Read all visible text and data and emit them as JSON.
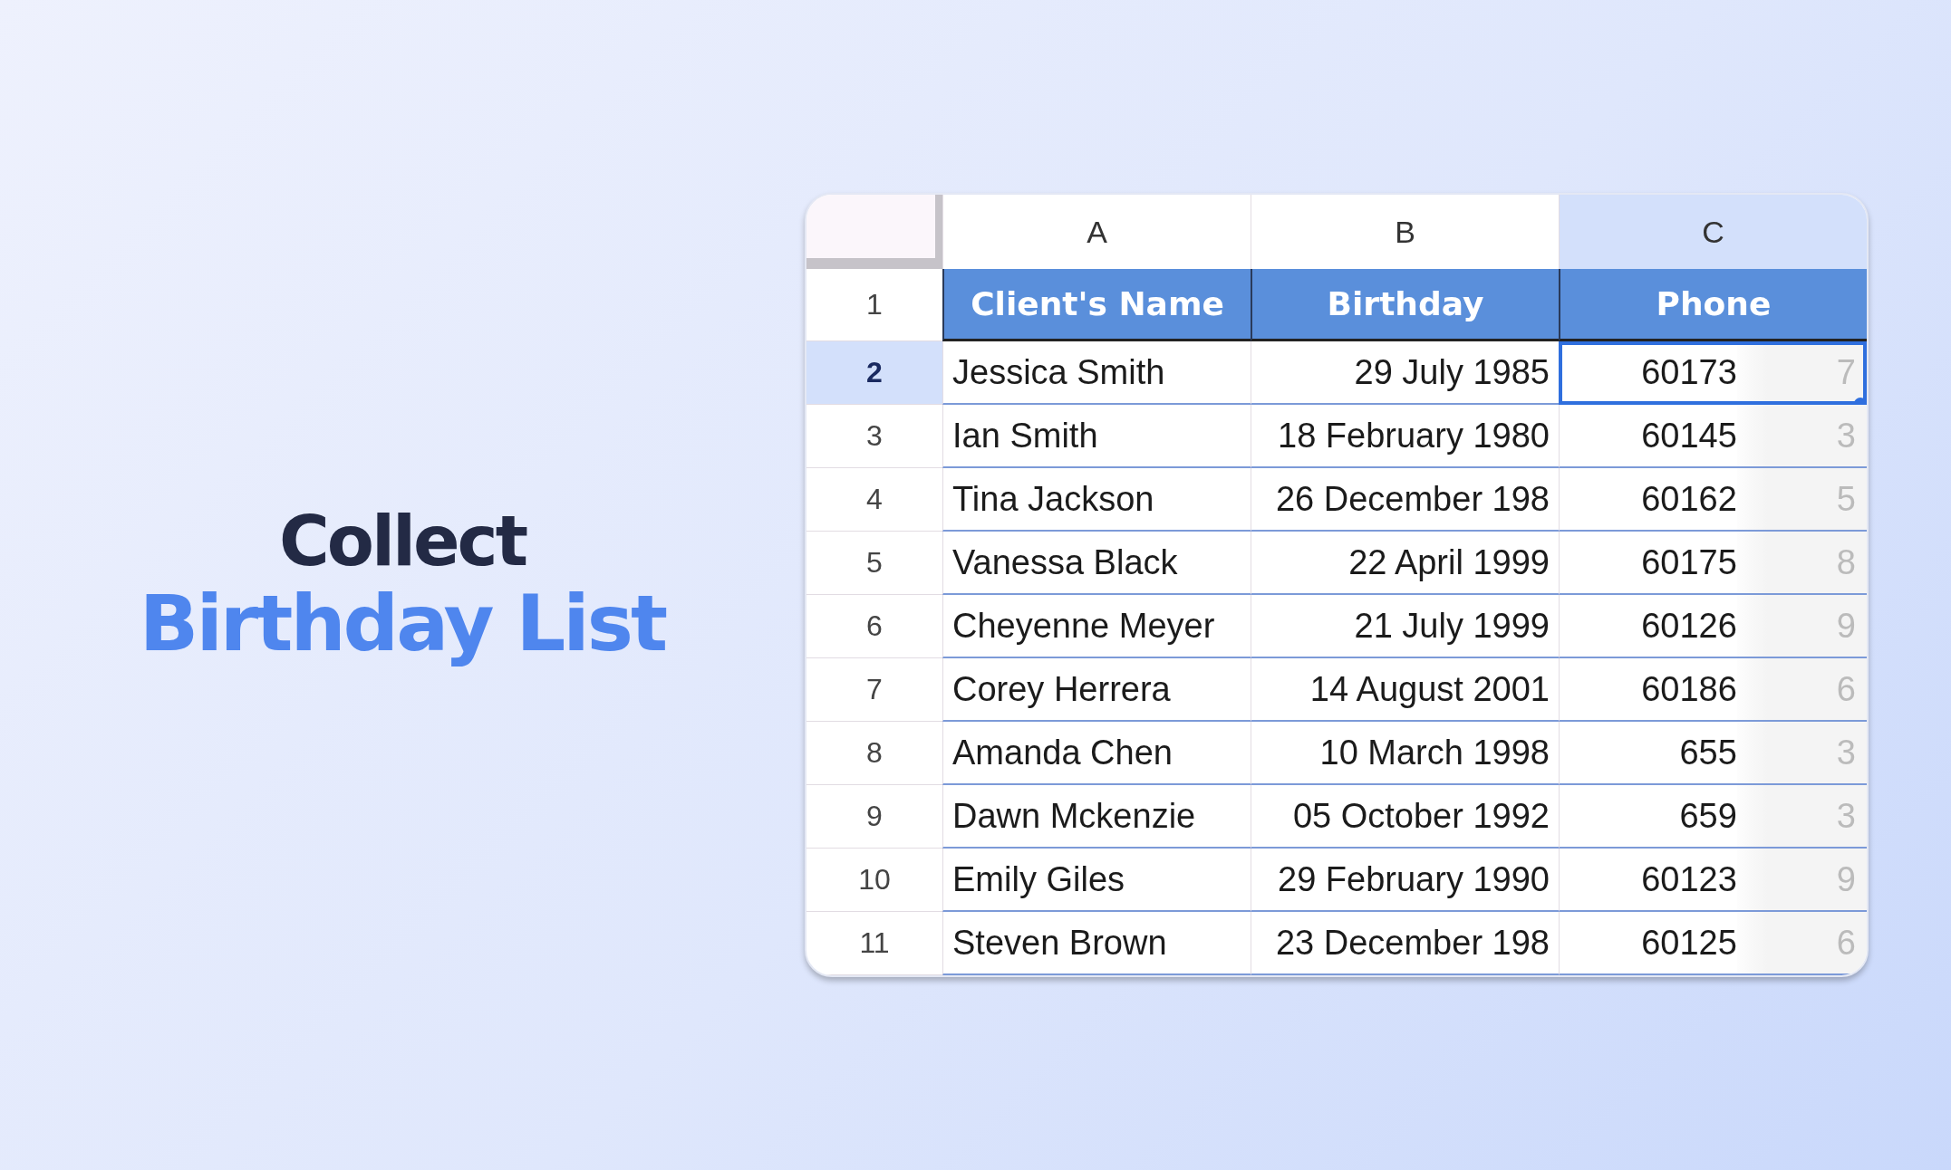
{
  "headline": {
    "line_1": "Collect",
    "line_2": "Birthday List"
  },
  "sheet": {
    "columns": [
      {
        "label": "A",
        "selected": false
      },
      {
        "label": "B",
        "selected": false
      },
      {
        "label": "C",
        "selected": true
      }
    ],
    "header_row": {
      "number": "1",
      "cells": [
        "Client's Name",
        "Birthday",
        "Phone"
      ]
    },
    "rows": [
      {
        "number": "2",
        "selected": true,
        "name": "Jessica Smith",
        "birthday": "29 July 1985",
        "phone": "60173",
        "phone_end": "7"
      },
      {
        "number": "3",
        "selected": false,
        "name": "Ian Smith",
        "birthday": "18 February 1980",
        "phone": "60145",
        "phone_end": "3"
      },
      {
        "number": "4",
        "selected": false,
        "name": "Tina Jackson",
        "birthday": "26 December 198",
        "phone": "60162",
        "phone_end": "5"
      },
      {
        "number": "5",
        "selected": false,
        "name": "Vanessa Black",
        "birthday": "22 April 1999",
        "phone": "60175",
        "phone_end": "8"
      },
      {
        "number": "6",
        "selected": false,
        "name": "Cheyenne Meyer",
        "birthday": "21 July 1999",
        "phone": "60126",
        "phone_end": "9"
      },
      {
        "number": "7",
        "selected": false,
        "name": "Corey Herrera",
        "birthday": "14 August 2001",
        "phone": "60186",
        "phone_end": "6"
      },
      {
        "number": "8",
        "selected": false,
        "name": "Amanda Chen",
        "birthday": "10 March 1998",
        "phone": "655",
        "phone_end": "3"
      },
      {
        "number": "9",
        "selected": false,
        "name": "Dawn Mckenzie",
        "birthday": "05 October 1992",
        "phone": "659",
        "phone_end": "3"
      },
      {
        "number": "10",
        "selected": false,
        "name": "Emily Giles",
        "birthday": "29 February 1990",
        "phone": "60123",
        "phone_end": "9"
      },
      {
        "number": "11",
        "selected": false,
        "name": "Steven Brown",
        "birthday": "23 December 198",
        "phone": "60125",
        "phone_end": "6"
      }
    ]
  }
}
